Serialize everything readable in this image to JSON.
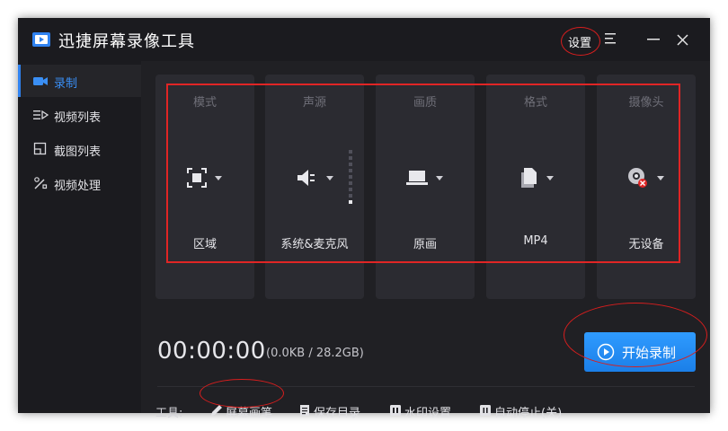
{
  "app": {
    "title": "迅捷屏幕录像工具",
    "settings_label": "设置"
  },
  "sidebar": {
    "items": [
      {
        "label": "录制",
        "active": true
      },
      {
        "label": "视频列表"
      },
      {
        "label": "截图列表"
      },
      {
        "label": "视频处理"
      }
    ]
  },
  "options": [
    {
      "title": "模式",
      "value": "区域",
      "icon": "region-select-icon"
    },
    {
      "title": "声源",
      "value": "系统&麦克风",
      "icon": "speaker-icon"
    },
    {
      "title": "画质",
      "value": "原画",
      "icon": "laptop-icon"
    },
    {
      "title": "格式",
      "value": "MP4",
      "icon": "file-icon"
    },
    {
      "title": "摄像头",
      "value": "无设备",
      "icon": "webcam-disabled-icon"
    }
  ],
  "status": {
    "timer": "00:00:00",
    "storage": "(0.0KB / 28.2GB)"
  },
  "record_button": {
    "label": "开始录制"
  },
  "tools": {
    "label": "工具:",
    "items": [
      {
        "label": "屏幕画笔"
      },
      {
        "label": "保存目录"
      },
      {
        "label": "水印设置"
      },
      {
        "label": "自动停止(关)"
      }
    ]
  },
  "colors": {
    "accent": "#2f82f0",
    "background": "#1b1b1f",
    "card": "#2b2b31",
    "annotation": "#e02525"
  }
}
